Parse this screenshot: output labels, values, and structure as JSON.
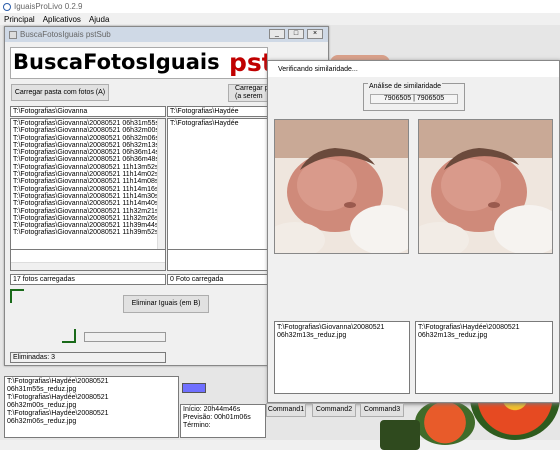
{
  "app": {
    "title": "IguaisProLivo 0.2.9"
  },
  "menu": [
    "Principal",
    "Aplicativos",
    "Ajuda"
  ],
  "child": {
    "title": "BuscaFotosIguais pstSub",
    "controls": [
      "_",
      "□",
      "×"
    ],
    "banner_main": "BuscaFotosIguais",
    "banner_suffix": "pst",
    "btn_load_a": "Carregar pasta com fotos (A)",
    "btn_load_b_line1": "Carregar pa",
    "btn_load_b_line2": "(a serem",
    "path_a": "T:\\Fotografias\\Giovanna",
    "path_b": "T:\\Fotografias\\Haydée",
    "list_a": [
      "T:\\Fotografias\\Giovanna\\20080521 06h31m55s_",
      "T:\\Fotografias\\Giovanna\\20080521 06h32m00s_",
      "T:\\Fotografias\\Giovanna\\20080521 06h32m06s_",
      "T:\\Fotografias\\Giovanna\\20080521 06h32m13s_",
      "T:\\Fotografias\\Giovanna\\20080521 06h36m14s_",
      "T:\\Fotografias\\Giovanna\\20080521 06h36m48s_",
      "T:\\Fotografias\\Giovanna\\20080521 11h13m52s_",
      "T:\\Fotografias\\Giovanna\\20080521 11h14m02s_",
      "T:\\Fotografias\\Giovanna\\20080521 11h14m08s_",
      "T:\\Fotografias\\Giovanna\\20080521 11h14m16s_",
      "T:\\Fotografias\\Giovanna\\20080521 11h14m30s_",
      "T:\\Fotografias\\Giovanna\\20080521 11h14m40s_",
      "T:\\Fotografias\\Giovanna\\20080521 11h32m21s_",
      "T:\\Fotografias\\Giovanna\\20080521 11h32m26s_",
      "T:\\Fotografias\\Giovanna\\20080521 11h39m44s_",
      "T:\\Fotografias\\Giovanna\\20080521 11h39m52s_"
    ],
    "list_b": [
      "T:\\Fotografias\\Haydée"
    ],
    "count_a": "17 fotos carregadas",
    "count_b": "0 Foto carregada",
    "btn_eliminate": "Eliminar Iguais (em B)",
    "eliminated": "Eliminadas: 3"
  },
  "modal": {
    "title": "Verificando similaridade...",
    "sim_label": "Análise de similaridade",
    "sim_value": "7906505 | 7906505",
    "left_path_line1": "T:\\Fotografias\\Giovanna\\20080521",
    "left_path_line2": "06h32m13s_reduz.jpg",
    "right_path_line1": "T:\\Fotografias\\Haydée\\20080521",
    "right_path_line2": "06h32m13s_reduz.jpg"
  },
  "bottom": {
    "files": [
      "T:\\Fotografias\\Haydée\\20080521 06h31m55s_reduz.jpg",
      "T:\\Fotografias\\Haydée\\20080521 06h32m00s_reduz.jpg",
      "T:\\Fotografias\\Haydée\\20080521 06h32m06s_reduz.jpg"
    ],
    "start": "Início:   20h44m46s",
    "forecast": "Previsão:  00h01m06s",
    "end": "Término:",
    "commands": [
      "Command1",
      "Command2",
      "Command3"
    ]
  }
}
